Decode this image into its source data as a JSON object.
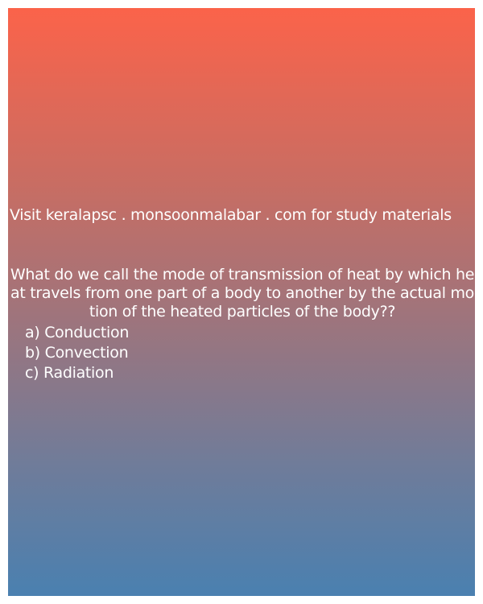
{
  "promo": {
    "text": "Visit keralapsc . monsoonmalabar . com for study materials"
  },
  "question": {
    "text": "What do we call the mode of transmission of heat by which heat travels from one part of a body to another by the actual motion of the heated particles of the body??"
  },
  "options": [
    {
      "label": "a) Conduction"
    },
    {
      "label": "b) Convection"
    },
    {
      "label": "c) Radiation"
    }
  ],
  "colors": {
    "gradient_top": "#fb634a",
    "gradient_bottom": "#4a80b0",
    "text": "#ffffff"
  }
}
